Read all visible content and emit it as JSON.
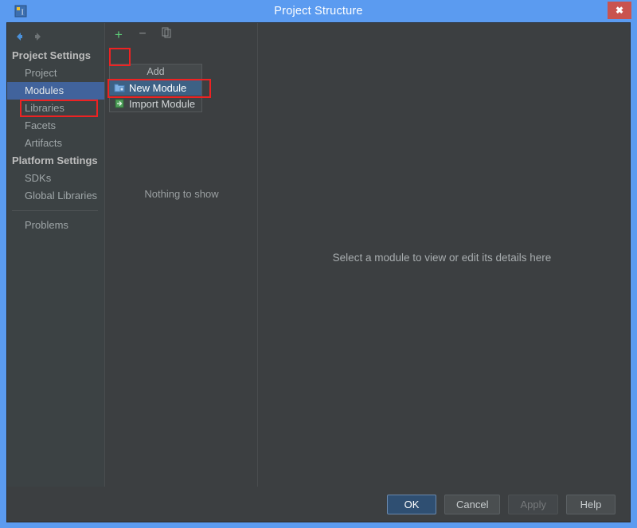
{
  "window": {
    "title": "Project Structure",
    "app_icon": "intellij-logo-icon",
    "close_label": "✖"
  },
  "toolbar": {
    "back_icon": "back-arrow-icon",
    "forward_icon": "forward-arrow-icon",
    "add_label": "+",
    "remove_label": "−",
    "copy_icon": "copy-icon"
  },
  "sidebar": {
    "groups": [
      {
        "label": "Project Settings",
        "items": [
          {
            "label": "Project",
            "selected": false
          },
          {
            "label": "Modules",
            "selected": true
          },
          {
            "label": "Libraries",
            "selected": false
          },
          {
            "label": "Facets",
            "selected": false
          },
          {
            "label": "Artifacts",
            "selected": false
          }
        ]
      },
      {
        "label": "Platform Settings",
        "items": [
          {
            "label": "SDKs",
            "selected": false
          },
          {
            "label": "Global Libraries",
            "selected": false
          }
        ]
      }
    ],
    "extra_items": [
      {
        "label": "Problems",
        "selected": false
      }
    ]
  },
  "middle_panel": {
    "empty_text": "Nothing to show"
  },
  "right_panel": {
    "hint_text": "Select a module to view or edit its details here"
  },
  "add_menu": {
    "header": "Add",
    "items": [
      {
        "label": "New Module",
        "icon": "new-module-folder-icon",
        "highlighted": true
      },
      {
        "label": "Import Module",
        "icon": "import-module-icon",
        "highlighted": false
      }
    ]
  },
  "buttons": {
    "ok": "OK",
    "cancel": "Cancel",
    "apply": "Apply",
    "help": "Help"
  },
  "colors": {
    "title_bar": "#5b9bf0",
    "dialog_background": "#3c3f41",
    "sidebar_background": "#3c4244",
    "selection_blue": "#41639c",
    "menu_highlight": "#3d6185",
    "accent_green": "#5fd07a",
    "close_red": "#c9534f",
    "annotation_red": "#ee2222",
    "primary_button": "#2f4f72"
  }
}
